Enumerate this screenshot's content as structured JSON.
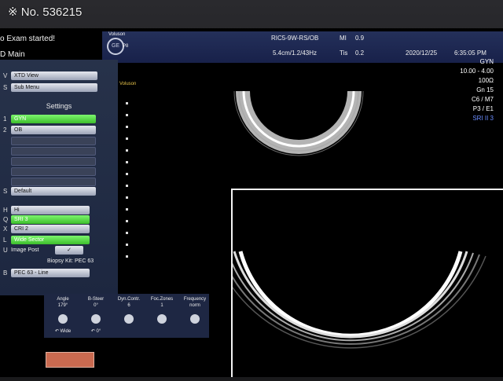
{
  "watermark": "※ No. 536215",
  "messages": {
    "exam": "o Exam started!",
    "mode": "D Main"
  },
  "header": {
    "logo_caption": "Voluson",
    "logo_sub": "P8",
    "probe": "RIC5-9W-RS/OB",
    "mi_label": "MI",
    "mi_value": "0.9",
    "depth": "5.4cm/1.2/43Hz",
    "tis_label": "Tis",
    "tis_value": "0.2",
    "date": "2020/12/25",
    "time": "6:35:05 PM"
  },
  "right_info": [
    "GYN",
    "10.00 - 4.00",
    "100Ω",
    "Gn 15",
    "C6 / M7",
    "P3 / E1",
    "SRI II 3"
  ],
  "left_menu": {
    "v_key": "V",
    "xtd_view": "XTD View",
    "s_key": "S",
    "sub_menu": "Sub Menu",
    "settings_title": "Settings",
    "item1_key": "1",
    "item1": "GYN",
    "item2_key": "2",
    "item2": "OB",
    "default_key": "S",
    "default": "Default",
    "h_key": "H",
    "h_item": "Hi",
    "q_key": "Q",
    "q_item": "SRI 3",
    "x_key": "X",
    "x_item": "CRI 2",
    "l_key": "L",
    "l_item": "Wide Sector",
    "u_key": "U",
    "u_item": "Image Post",
    "biopsy_title": "Biopsy Kit: PEC 63",
    "b_key": "B",
    "b_item": "PEC 63 - Line"
  },
  "knobs": [
    {
      "label": "Angle",
      "value": "179°",
      "bottom": "↶ Wide"
    },
    {
      "label": "B-Steer",
      "value": "0°",
      "bottom": "↶ 0°"
    },
    {
      "label": "Dyn.Contr.",
      "value": "6",
      "bottom": ""
    },
    {
      "label": "Foc.Zones",
      "value": "1",
      "bottom": ""
    },
    {
      "label": "Frequency",
      "value": "norm",
      "bottom": ""
    }
  ]
}
